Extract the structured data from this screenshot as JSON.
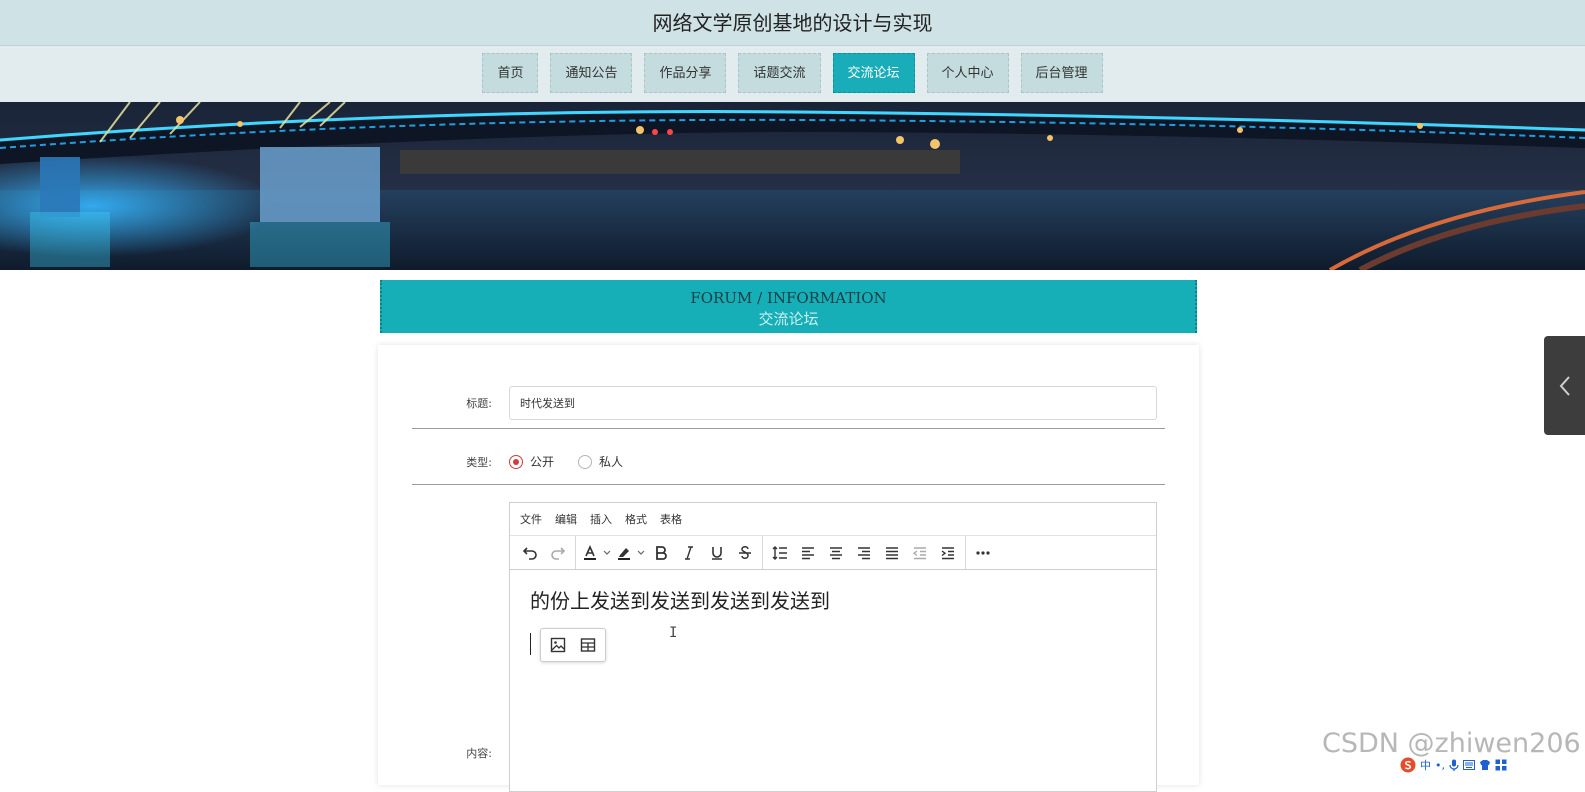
{
  "site": {
    "title": "网络文学原创基地的设计与实现"
  },
  "nav": {
    "items": [
      "首页",
      "通知公告",
      "作品分享",
      "话题交流",
      "交流论坛",
      "个人中心",
      "后台管理"
    ],
    "active_index": 4
  },
  "section": {
    "title_en": "FORUM / INFORMATION",
    "title_cn": "交流论坛"
  },
  "form": {
    "title_label": "标题:",
    "title_value": "时代发送到",
    "type_label": "类型:",
    "type_options": [
      "公开",
      "私人"
    ],
    "type_selected": "公开",
    "content_label": "内容:"
  },
  "editor": {
    "menus": [
      "文件",
      "编辑",
      "插入",
      "格式",
      "表格"
    ],
    "toolbar_icons": [
      "undo-icon",
      "redo-icon",
      "text-color-icon",
      "highlight-icon",
      "bold-icon",
      "italic-icon",
      "underline-icon",
      "strikethrough-icon",
      "line-height-icon",
      "align-left-icon",
      "align-center-icon",
      "align-right-icon",
      "align-justify-icon",
      "outdent-icon",
      "indent-icon",
      "more-icon"
    ],
    "content_text": "的份上发送到发送到发送到发送到",
    "quickbar_icons": [
      "image-icon",
      "table-icon"
    ]
  },
  "colors": {
    "accent": "#18adb8",
    "topbar": "#cfe2e5",
    "radio_checked": "#d23b3b"
  },
  "watermark": "CSDN @zhiwen206",
  "ime": {
    "label": "中"
  }
}
